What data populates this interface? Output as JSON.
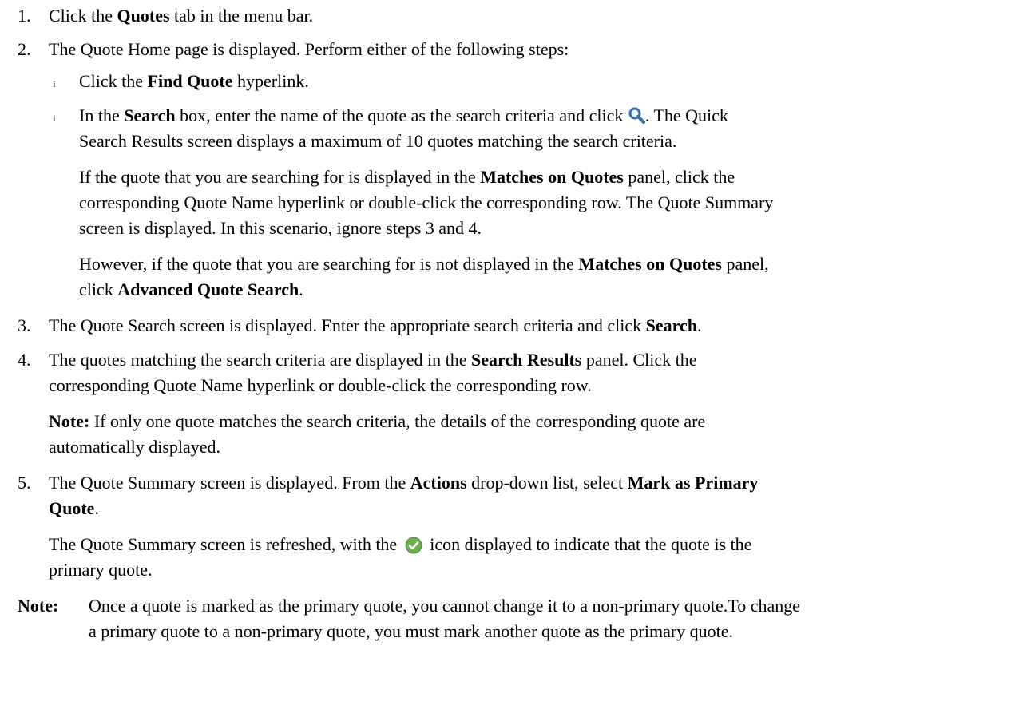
{
  "steps": {
    "s1": {
      "num": "1.",
      "pre": "Click the ",
      "bold": "Quotes",
      "post": " tab in the menu bar."
    },
    "s2": {
      "num": "2.",
      "text": "The Quote Home page is displayed. Perform either of the following steps:"
    },
    "b1": {
      "pre": "Click the ",
      "bold": "Find Quote",
      "post": " hyperlink."
    },
    "b2": {
      "l1_pre": "In the ",
      "l1_bold": "Search",
      "l1_mid": " box, enter the name of the quote as the search criteria and click ",
      "l1_post": ". The Quick",
      "l2": "Search Results screen displays a maximum of 10 quotes matching the search criteria."
    },
    "p1": {
      "l1_pre": "If the quote that you are searching for is displayed in the ",
      "l1_bold": "Matches on Quotes",
      "l1_post": " panel, click the",
      "l2": "corresponding Quote Name hyperlink or double-click the corresponding row. The Quote Summary",
      "l3": "screen is displayed. In this scenario, ignore steps 3 and 4."
    },
    "p2": {
      "l1_pre": "However, if the quote that you are searching for is not displayed in the ",
      "l1_bold": "Matches on Quotes",
      "l1_post": " panel,",
      "l2_pre": "click ",
      "l2_bold": "Advanced Quote Search",
      "l2_post": "."
    },
    "s3": {
      "num": "3.",
      "pre": "The Quote Search screen is displayed. Enter the appropriate search criteria and click ",
      "bold": "Search",
      "post": "."
    },
    "s4": {
      "num": "4.",
      "l1_pre": "The quotes matching the search criteria are displayed in the ",
      "l1_bold": "Search Results",
      "l1_post": " panel. Click the",
      "l2": "corresponding Quote Name hyperlink or double-click the corresponding row."
    },
    "note1": {
      "label": "Note:",
      "l1": " If only one quote matches the search criteria, the details of the corresponding quote are",
      "l2": "automatically displayed."
    },
    "s5": {
      "num": "5.",
      "l1_pre": "The Quote Summary screen is displayed. From the ",
      "l1_bold": "Actions",
      "l1_mid": " drop-down list, select ",
      "l1_bold2": "Mark as Primary",
      "l2_bold": "Quote",
      "l2_post": "."
    },
    "p3": {
      "l1_pre": "The Quote Summary screen is refreshed, with the ",
      "l1_post": " icon displayed to indicate that the quote is the",
      "l2": "primary quote."
    }
  },
  "final_note": {
    "label": "Note:",
    "l1": "Once a quote is marked as the primary quote, you cannot change it to a non-primary quote.To change",
    "l2": "a primary quote to a non-primary quote, you must mark another quote as the primary quote."
  },
  "icons": {
    "search": "search-icon",
    "check": "check-circle-icon"
  },
  "colors": {
    "search_icon": "#2f6db5",
    "check_fill": "#6ab04c"
  }
}
